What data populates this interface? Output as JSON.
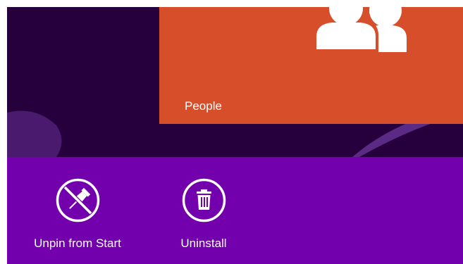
{
  "start": {
    "background_color": "#25003c",
    "tile": {
      "label": "People",
      "color": "#d64f2a",
      "icon": "people-icon"
    }
  },
  "app_bar": {
    "background_color": "#7200ac",
    "commands": [
      {
        "label": "Unpin from Start",
        "icon": "unpin-icon"
      },
      {
        "label": "Uninstall",
        "icon": "trash-icon"
      }
    ]
  }
}
